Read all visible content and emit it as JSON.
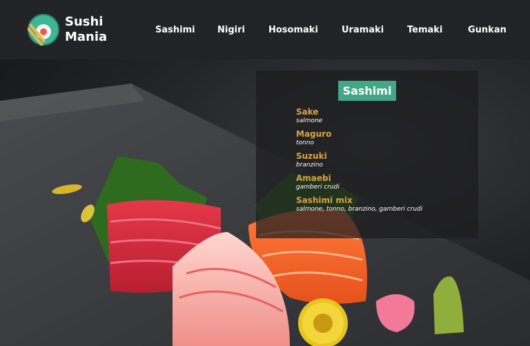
{
  "brand": {
    "line1": "Sushi",
    "line2": "Mania"
  },
  "nav": {
    "items": [
      {
        "label": "Sashimi"
      },
      {
        "label": "Nigiri"
      },
      {
        "label": "Hosomaki"
      },
      {
        "label": "Uramaki"
      },
      {
        "label": "Temaki"
      },
      {
        "label": "Gunkan"
      }
    ]
  },
  "menu": {
    "title": "Sashimi",
    "items": [
      {
        "name": "Sake",
        "desc": "salmone"
      },
      {
        "name": "Maguro",
        "desc": "tonno"
      },
      {
        "name": "Suzuki",
        "desc": "branzino"
      },
      {
        "name": "Amaebi",
        "desc": "gamberi crudi"
      },
      {
        "name": "Sashimi mix",
        "desc": "salmone, tonno, branzino, gamberi crudi"
      }
    ]
  },
  "colors": {
    "accent": "#43a685",
    "item_name": "#d9a441",
    "navbar": "#222326"
  }
}
